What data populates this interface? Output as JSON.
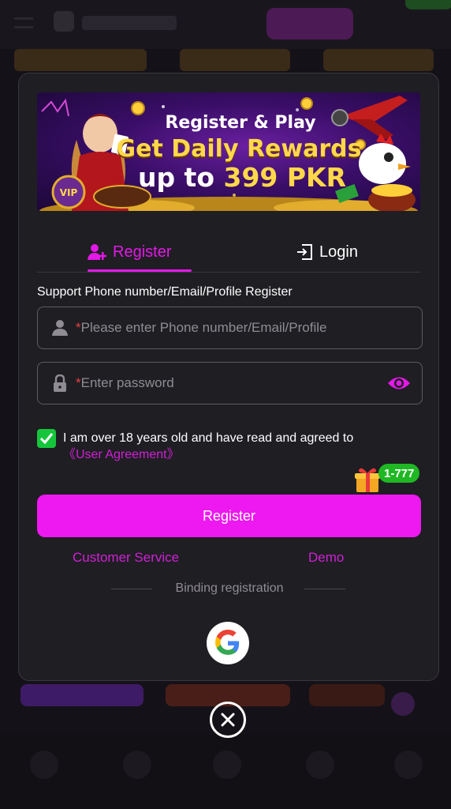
{
  "banner": {
    "line1": "Register & Play",
    "line2": "Get Daily Rewards",
    "line3_prefix": "up to ",
    "line3_highlight": "399 PKR",
    "vip_text": "VIP"
  },
  "tabs": {
    "register_label": "Register",
    "login_label": "Login",
    "active": "register"
  },
  "form": {
    "support_text": "Support Phone number/Email/Profile Register",
    "username_required_mark": "*",
    "username_placeholder": "Please enter Phone number/Email/Profile",
    "password_required_mark": "*",
    "password_placeholder": "Enter password",
    "agreement_checked": true,
    "agreement_text": "I am over 18 years old and have read and agreed to",
    "agreement_link": "《User Agreement》",
    "gift_badge": "1-777",
    "register_button": "Register"
  },
  "links": {
    "customer_service": "Customer Service",
    "demo": "Demo",
    "binding_registration": "Binding registration"
  },
  "colors": {
    "accent": "#ee18f0",
    "link": "#d020d6",
    "checkbox": "#15c63a",
    "required": "#e84242"
  },
  "icons": {
    "register_tab": "user-plus-icon",
    "login_tab": "login-icon",
    "username": "user-icon",
    "password": "lock-icon",
    "toggle": "eye-icon",
    "social": "google-icon",
    "close": "close-icon"
  }
}
